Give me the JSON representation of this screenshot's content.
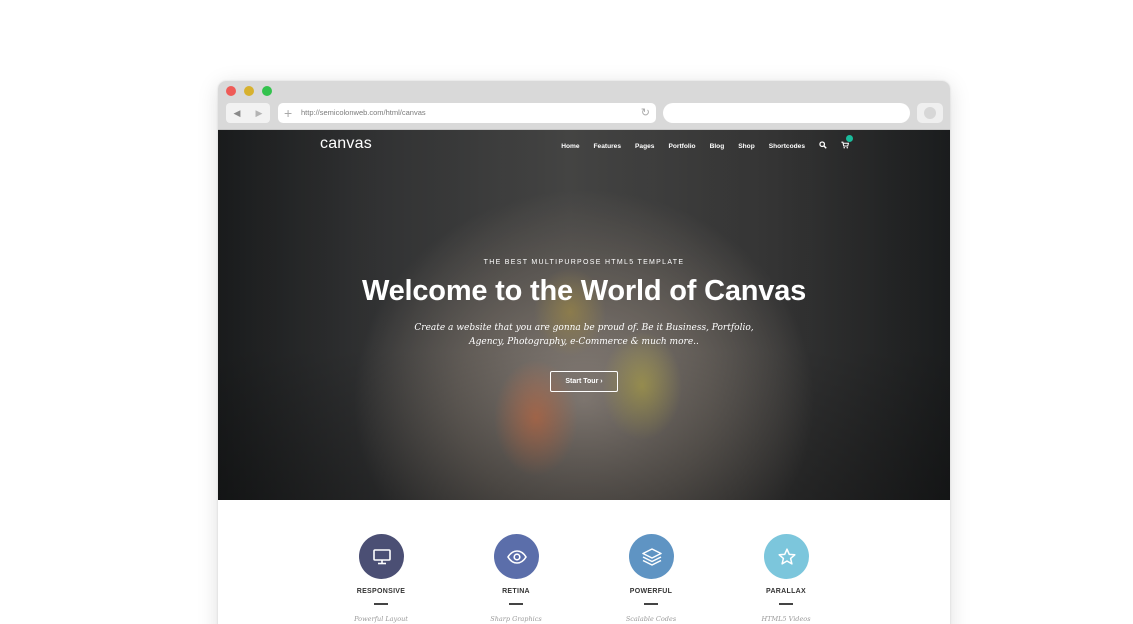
{
  "browser": {
    "url": "http://semicolonweb.com/html/canvas",
    "back_icon": "◀",
    "forward_icon": "▶",
    "new_tab_icon": "+",
    "reload_icon": "↻",
    "search_value": ""
  },
  "site": {
    "logo": "canvas",
    "nav": [
      "Home",
      "Features",
      "Pages",
      "Portfolio",
      "Blog",
      "Shop",
      "Shortcodes"
    ],
    "accent_color": "#1abc9c"
  },
  "hero": {
    "kicker": "THE BEST MULTIPURPOSE HTML5 TEMPLATE",
    "title": "Welcome to the World of Canvas",
    "desc_line1": "Create a website that you are gonna be proud of. Be it Business, Portfolio,",
    "desc_line2": "Agency, Photography, e-Commerce & much more..",
    "button": "Start Tour",
    "button_icon": "›"
  },
  "features": [
    {
      "title": "RESPONSIVE",
      "subtitle": "Powerful Layout",
      "icon": "monitor-icon",
      "color": "#4b4f74"
    },
    {
      "title": "RETINA",
      "subtitle": "Sharp Graphics",
      "icon": "eye-icon",
      "color": "#5b6eaa"
    },
    {
      "title": "POWERFUL",
      "subtitle": "Scalable Codes",
      "icon": "layers-icon",
      "color": "#5f94c3"
    },
    {
      "title": "PARALLAX",
      "subtitle": "HTML5 Videos",
      "icon": "star-icon",
      "color": "#7cc6dc"
    }
  ]
}
